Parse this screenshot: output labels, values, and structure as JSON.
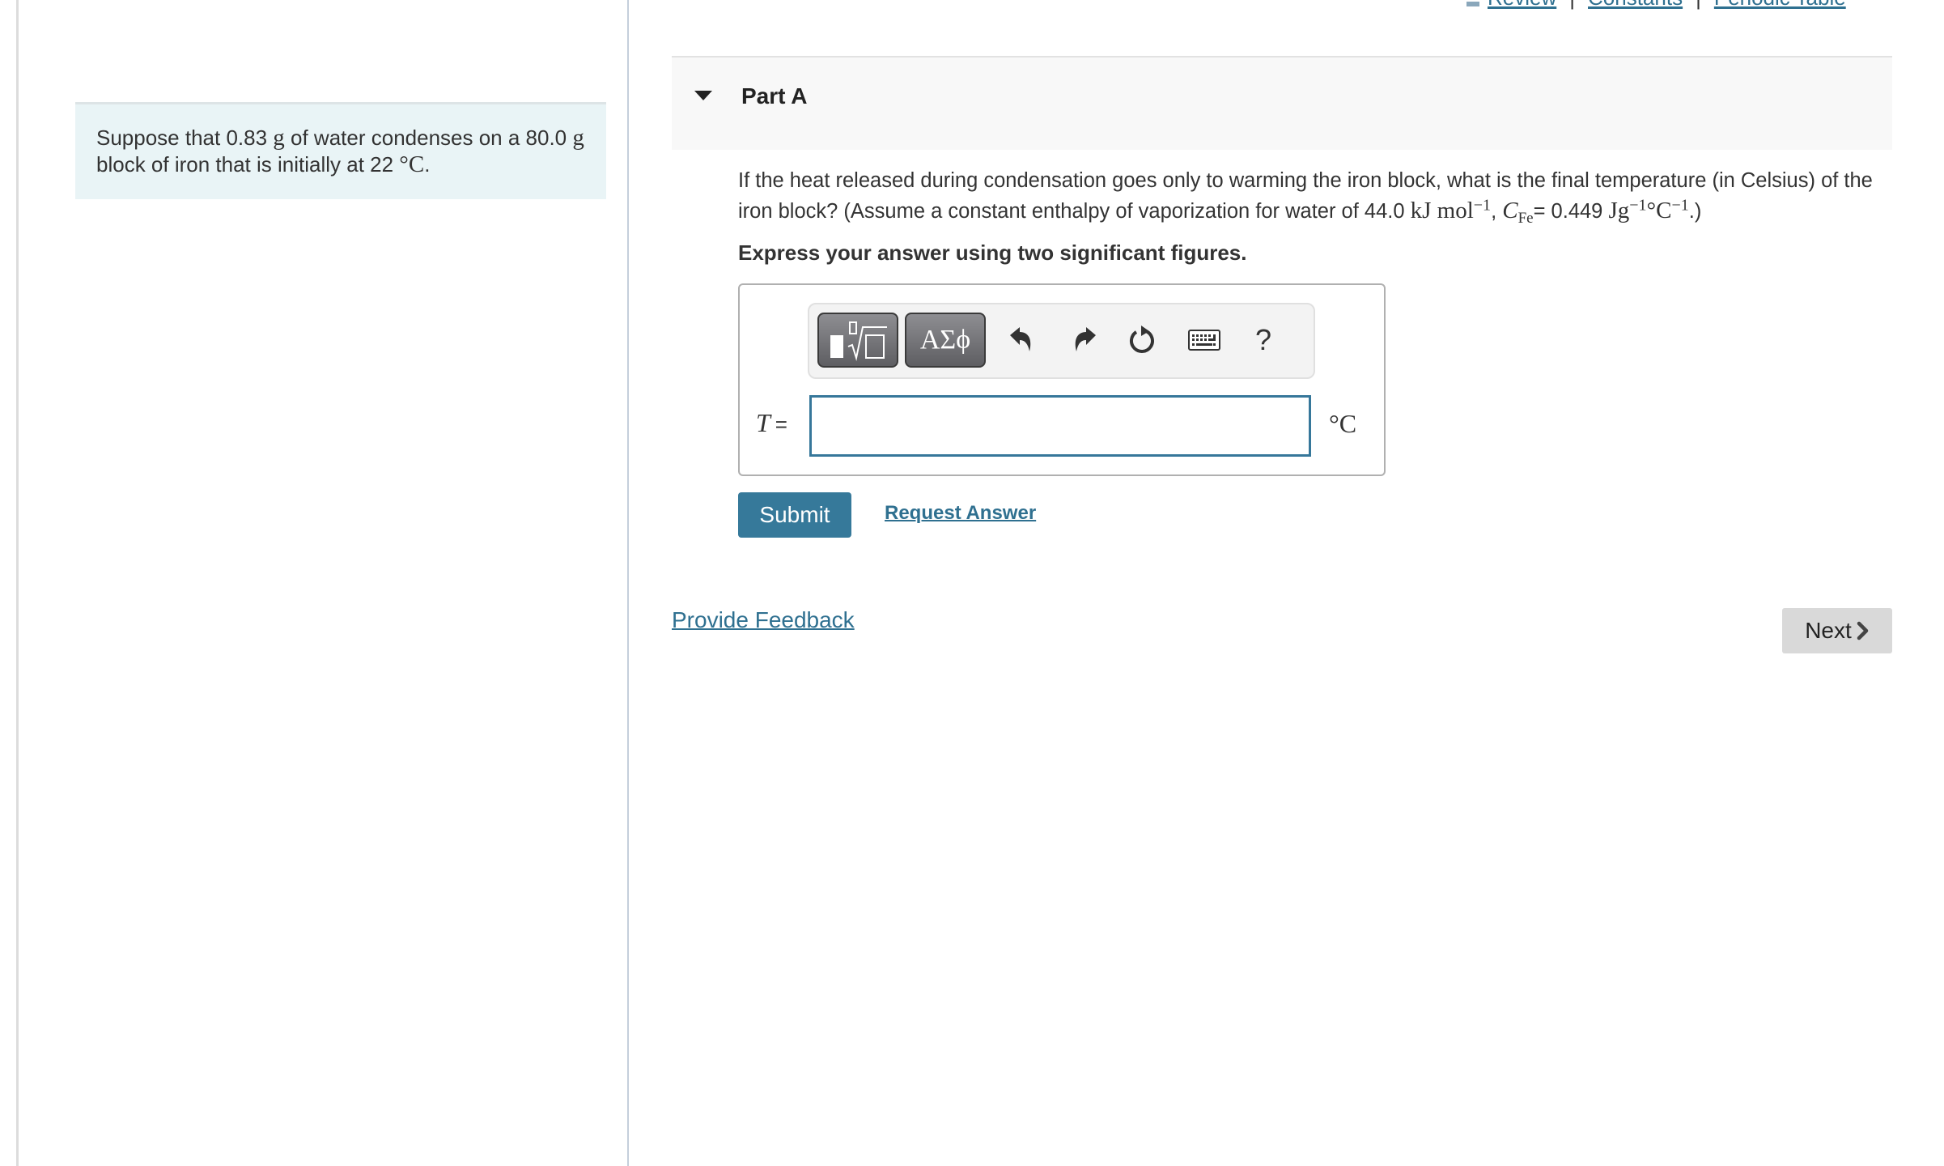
{
  "top_links": {
    "review": "Review",
    "constants": "Constants",
    "periodic_table": "Periodic Table",
    "separator": "|"
  },
  "problem": {
    "text_before": "Suppose that 0.83 ",
    "unit_g1": "g",
    "text_mid": " of water condenses on a 80.0 ",
    "unit_g2": "g",
    "text_after": " block of iron that is initially at 22 ",
    "unit_temp": "°C",
    "end": "."
  },
  "part": {
    "title": "Part A",
    "expanded": true
  },
  "question": {
    "line": "If the heat released during condensation goes only to warming the iron block, what is the final temperature (in Celsius) of the iron block? (Assume a constant enthalpy of vaporization for water of 44.0 ",
    "unit1": "kJ mol",
    "unit1_exp": "−1",
    "sep": ", ",
    "c_symbol": "C",
    "c_sub": "Fe",
    "c_value": "= 0.449 ",
    "unit2_a": "Jg",
    "unit2_a_exp": "−1",
    "unit2_b": "°C",
    "unit2_b_exp": "−1",
    "end": ".)"
  },
  "instruction": "Express your answer using two significant figures.",
  "toolbar": {
    "templates_icon": "templates-sqrt-icon",
    "symbols_label": "ΑΣϕ",
    "undo_icon": "undo-icon",
    "redo_icon": "redo-icon",
    "reset_icon": "reset-icon",
    "keyboard_icon": "keyboard-icon",
    "help_label": "?"
  },
  "answer": {
    "variable": "T",
    "equals": "=",
    "value": "",
    "placeholder": "",
    "unit": "°C"
  },
  "actions": {
    "submit": "Submit",
    "request_answer": "Request Answer"
  },
  "footer": {
    "feedback": "Provide Feedback",
    "next": "Next"
  },
  "colors": {
    "accent": "#36799a",
    "link": "#2f7090",
    "problem_bg": "#e9f4f6",
    "header_bg": "#f8f8f8",
    "next_bg": "#d9d9d9"
  }
}
